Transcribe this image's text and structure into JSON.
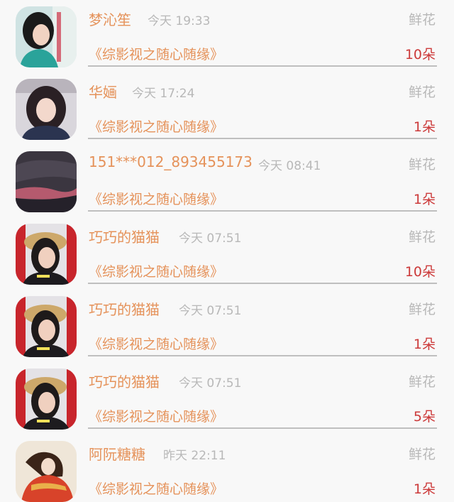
{
  "gifts": [
    {
      "name": "梦沁笙",
      "time": "今天 19:33",
      "gift": "鲜花",
      "show": "《综影视之随心随缘》",
      "count": "10朵",
      "avatar": "avatar-girl-teal"
    },
    {
      "name": "华婳",
      "time": "今天 17:24",
      "gift": "鲜花",
      "show": "《综影视之随心随缘》",
      "count": "1朵",
      "avatar": "avatar-girl-dark-hair"
    },
    {
      "name": "151***012_893455173",
      "time": "今天 08:41",
      "gift": "鲜花",
      "show": "《综影视之随心随缘》",
      "count": "1朵",
      "avatar": "avatar-sunset-clouds"
    },
    {
      "name": "巧巧的猫猫",
      "time": "今天 07:51",
      "gift": "鲜花",
      "show": "《综影视之随心随缘》",
      "count": "10朵",
      "avatar": "avatar-woman-straw-hat"
    },
    {
      "name": "巧巧的猫猫",
      "time": "今天 07:51",
      "gift": "鲜花",
      "show": "《综影视之随心随缘》",
      "count": "1朵",
      "avatar": "avatar-woman-straw-hat"
    },
    {
      "name": "巧巧的猫猫",
      "time": "今天 07:51",
      "gift": "鲜花",
      "show": "《综影视之随心随缘》",
      "count": "5朵",
      "avatar": "avatar-woman-straw-hat"
    },
    {
      "name": "阿阮糖糖",
      "time": "昨天 22:11",
      "gift": "鲜花",
      "show": "《综影视之随心随缘》",
      "count": "1朵",
      "avatar": "avatar-illustration-red-robe"
    }
  ],
  "colors": {
    "name": "#e5925a",
    "secondary": "#b8b8b8",
    "count": "#cc3a3a",
    "divider": "#bfbfbf",
    "background": "#f8f8f8"
  }
}
